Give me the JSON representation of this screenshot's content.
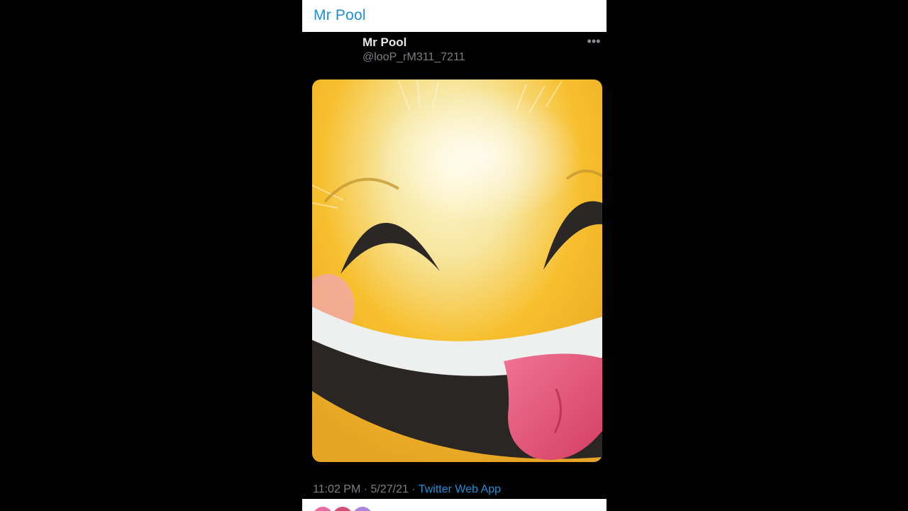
{
  "window": {
    "title": "Mr Pool"
  },
  "tweet": {
    "display_name": "Mr Pool",
    "handle": "@looP_rM311_7211",
    "more_icon": "more-horizontal-icon",
    "image": {
      "subject": "smiling face with tongue emoji foil balloon",
      "colors": {
        "face": "#f7bf2d",
        "highlight": "#fff7cf",
        "mouth": "#2a2623",
        "teeth": "#eef0ef",
        "tongue": "#e85a7b",
        "blush": "#f2a6b9"
      }
    },
    "time": "11:02 PM",
    "date": "5/27/21",
    "separator": "·",
    "source": "Twitter Web App"
  },
  "footer": {
    "avatar_colors": [
      "#ea6ba4",
      "#d34f75",
      "#a986d9"
    ]
  },
  "theme": {
    "accent": "#1d8fd6",
    "muted": "#7b7f84",
    "background": "#000000",
    "header_background": "#ffffff"
  }
}
